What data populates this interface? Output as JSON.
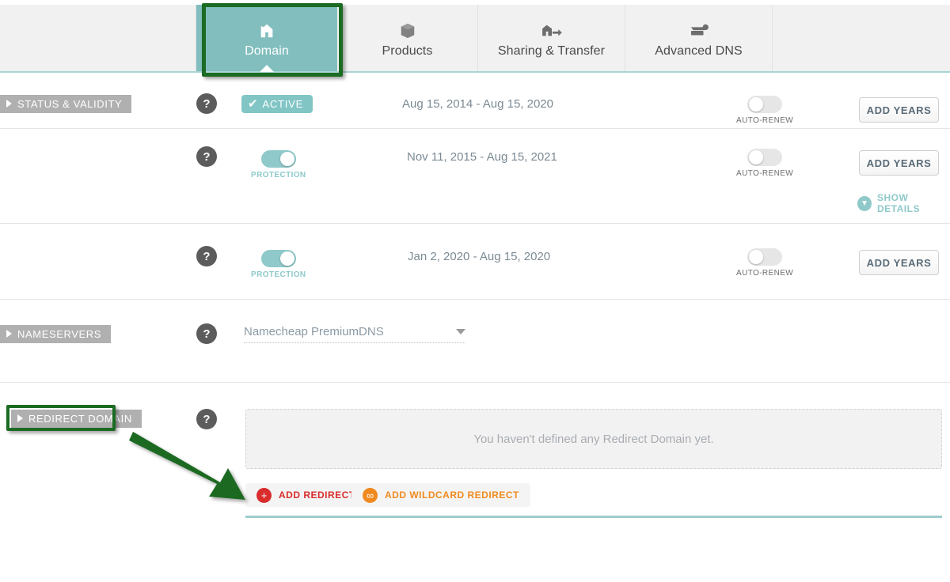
{
  "tabs": [
    {
      "label": "Domain",
      "icon": "home-icon",
      "active": true
    },
    {
      "label": "Products",
      "icon": "box-icon",
      "active": false
    },
    {
      "label": "Sharing & Transfer",
      "icon": "transfer-icon",
      "active": false
    },
    {
      "label": "Advanced DNS",
      "icon": "server-icon",
      "active": false
    }
  ],
  "sections": {
    "status_validity": {
      "label": "STATUS & VALIDITY",
      "help_icon": "question-mark-icon",
      "rows": [
        {
          "status_badge": "ACTIVE",
          "date_range": "Aug 15, 2014 - Aug 15, 2020",
          "autorenew_label": "AUTO-RENEW",
          "autorenew_on": false,
          "add_years_label": "ADD YEARS"
        },
        {
          "toggle_label": "PROTECTION",
          "toggle_on": true,
          "date_range": "Nov 11, 2015 - Aug 15, 2021",
          "autorenew_label": "AUTO-RENEW",
          "autorenew_on": false,
          "add_years_label": "ADD YEARS",
          "show_details_label": "SHOW DETAILS"
        },
        {
          "toggle_label": "PROTECTION",
          "toggle_on": true,
          "date_range": "Jan 2, 2020 - Aug 15, 2020",
          "autorenew_label": "AUTO-RENEW",
          "autorenew_on": false,
          "add_years_label": "ADD YEARS"
        }
      ]
    },
    "nameservers": {
      "label": "NAMESERVERS",
      "help_icon": "question-mark-icon",
      "selected_value": "Namecheap PremiumDNS"
    },
    "redirect_domain": {
      "label": "REDIRECT DOMAIN",
      "help_icon": "question-mark-icon",
      "empty_text": "You haven't defined any Redirect Domain yet.",
      "add_redirect_label": "ADD REDIRECT",
      "add_wildcard_label": "ADD WILDCARD REDIRECT"
    }
  },
  "colors": {
    "accent_teal": "#82bebe",
    "toggle_on": "#8fc9c9",
    "section_label_bg": "#b0b0b0",
    "annotation_green": "#1b6b22",
    "add_redirect_red": "#d92c2c",
    "add_wildcard_orange": "#f08a1e"
  }
}
